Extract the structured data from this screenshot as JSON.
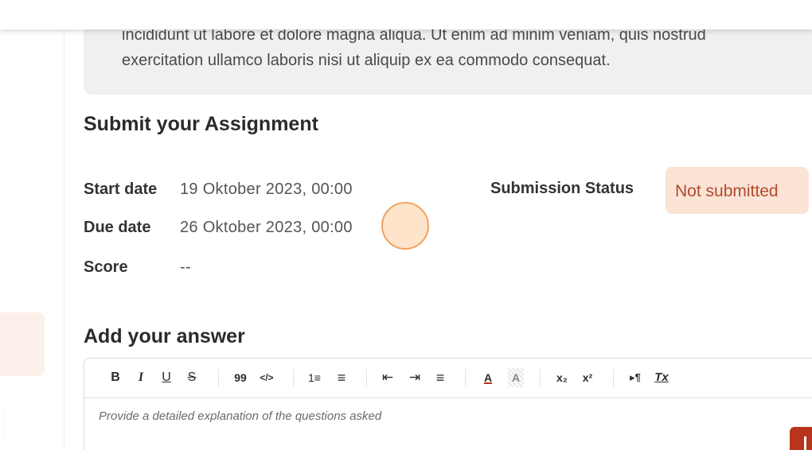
{
  "description": {
    "line1": "incididunt ut labore et dolore magna aliqua. Ut enim ad minim veniam, quis nostrud",
    "line2": "exercitation ullamco laboris nisi ut aliquip ex ea commodo consequat."
  },
  "assignment": {
    "title": "Submit your Assignment",
    "start_label": "Start date",
    "start_value": "19 Oktober 2023, 00:00",
    "due_label": "Due date",
    "due_value": "26 Oktober 2023, 00:00",
    "score_label": "Score",
    "score_value": "--",
    "status_label": "Submission Status",
    "status_value": "Not submitted"
  },
  "answer": {
    "title": "Add your answer",
    "placeholder": "Provide a detailed explanation of the questions asked"
  },
  "toolbar": {
    "bold": "B",
    "italic": "I",
    "underline": "U",
    "strike": "S",
    "quote": "99",
    "code": "</>",
    "ordered_list": "1≡",
    "bullet_list": "≡",
    "outdent": "⇤",
    "indent": "⇥",
    "align": "≡",
    "text_color": "A",
    "highlight": "A",
    "subscript": "x₂",
    "superscript": "x²",
    "direction": "▸¶",
    "clear_format": "Tx"
  },
  "colors": {
    "accent": "#b8341c",
    "status_bg": "#fbe3d6",
    "status_text": "#b04b2b"
  }
}
